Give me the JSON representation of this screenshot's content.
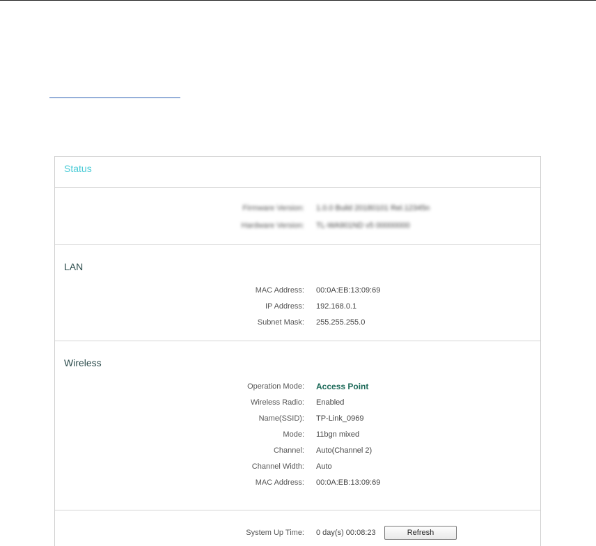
{
  "panel": {
    "title": "Status"
  },
  "firmware": {
    "rows": [
      {
        "label": "Firmware Version:",
        "value": "1.0.0 Build 20180101 Rel.12345n"
      },
      {
        "label": "Hardware Version:",
        "value": "TL-WA901ND v5 00000000"
      }
    ]
  },
  "lan": {
    "title": "LAN",
    "rows": [
      {
        "label": "MAC Address:",
        "value": "00:0A:EB:13:09:69"
      },
      {
        "label": "IP Address:",
        "value": "192.168.0.1"
      },
      {
        "label": "Subnet Mask:",
        "value": "255.255.255.0"
      }
    ]
  },
  "wireless": {
    "title": "Wireless",
    "rows": [
      {
        "label": "Operation Mode:",
        "value": "Access Point"
      },
      {
        "label": "Wireless Radio:",
        "value": "Enabled"
      },
      {
        "label": "Name(SSID):",
        "value": "TP-Link_0969"
      },
      {
        "label": "Mode:",
        "value": "11bgn mixed"
      },
      {
        "label": "Channel:",
        "value": "Auto(Channel 2)"
      },
      {
        "label": "Channel Width:",
        "value": "Auto"
      },
      {
        "label": "MAC Address:",
        "value": "00:0A:EB:13:09:69"
      }
    ]
  },
  "system": {
    "uptime_label": "System Up Time:",
    "uptime_value": "0 day(s) 00:08:23",
    "refresh_label": "Refresh"
  }
}
